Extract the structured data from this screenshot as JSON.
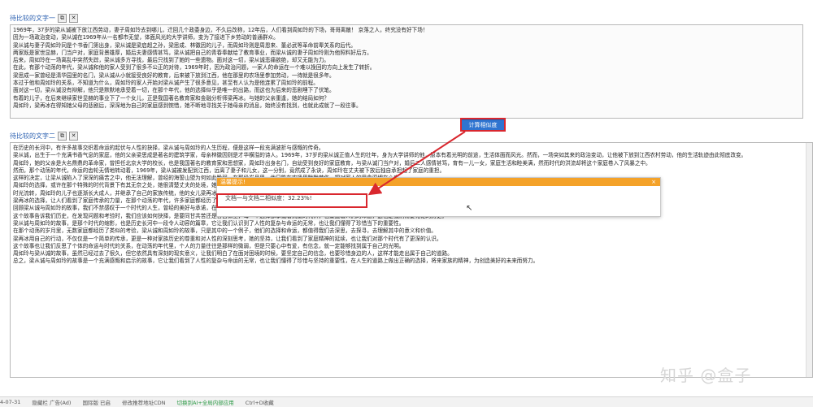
{
  "field1": {
    "label": "待比较的文字一",
    "lines": [
      "1969年，37岁的梁从诚被下放江西劳动，妻子周如玲去到哪儿，迁回几个政委身边，不久后改称，12年后，人们看到周如玲的下场，哥哥离散！ 京落之人，终究没有好下场！",
      "因为一场政治变动，梁从诚在1969年从一名都市无望，体面风光的大学讲师，变为了接进下乡劳动的普通群众。",
      "梁从诚与妻子周如玲同是个书香门第出身，梁从诚是梁启超之孙，梁思成、林徽因的儿子，而周如玲则是周恩来、董必武等革命前辈关系的后代。",
      "两家既是家世显赫，门当户对，家庭背景雄厚，婚后夫妻感情甚笃，梁从诚把自己的青春奉献给了教育事业，而梁从诚的妻子周如玲则为他照料好后方。",
      "后来，周如玲在一场离乱中突然失踪，梁从诚多方寻找，最后只找到了她的一些遗物。面对这一切，梁从诚悲痛欲绝，却又无能为力。",
      "在此，有那个动荡的年代，梁从诚和他的家人受到了很多不公正的对待，1969年时，因为政治问题，一家人的命运在一个难以挽回的方向上发生了转折。",
      "梁思成一家曾经是清华园里的名门，梁从诚从小就接受良好的教育，后来被下放到江西，他在那里的农场里参加劳动，一待就是很多年。",
      "本过于他和周如玲的关系，不知道为什么，周如玲的家人开始对梁从诚产生了很多意见，甚至有人认为是他连累了周如玲的前程。",
      "面对这一切，梁从诚没有辩解，他只是默默地承受着一切，在那个年代，他的选择似乎是唯一的出路，而这也为后来的悲剧埋下了伏笔。",
      "有着的儿子，在后来继续家世显赫的事业下了一个女儿，正是我国著名教育家和金融分析师梁再冰。与她的父亲重逢，她的结局如何？",
      "周如玲，梁再冰在得知她父母的悲剧后，深深地为自己的家庭感到惋惜，她不断地寻找关于她母亲的消息，始终没有找到，也就此成就了一段往事。"
    ]
  },
  "calc_button": "计算相似度",
  "field2": {
    "label": "待比较的文字二",
    "lines": [
      "在历史的长河中，有许多故事交织着命运的起伏与人性的抉择，梁从诚与周如玲的人生历程，便是这样一段充满波折与感慨的传奇。",
      "梁从诚，出生于一个充满书香气息的家庭，他的父亲梁思成是著名的建筑学家，母亲林徽因则是才华横溢的诗人。1969年，37岁的梁从诚正值人生的壮年，身为大学讲师的他，原本有着光明的前途，生活体面而风光。然而，一场突如其来的政治变动，让他被下放到江西农村劳动，他的生活轨迹由此彻底改变。",
      "周如玲，她的父亲是大名鼎鼎的革命家，曾担任北京大学的校长，也是我国著名的教育家和思想家，周如玲出身名门，自幼受到良好的家庭教育，与梁从诚门当户对，婚后二人感情甚笃，育有一儿一女，家庭生活和睦美满，然而时代的洪流却将这个家庭卷入了风暴之中。",
      "然而，那个动荡的年代，命运的齿轮无情地转动着，1969年，梁从诚被发配到江西，远离了妻子和儿女，这一分别，竟然成了永诀，周如玲在丈夫被下放后独自承担起了家庭的重担。",
      "这样的决定，让梁从诚陷入了深深的痛苦之中，他无法理解，曾经的海誓山盟为何如此脆弱，在那段岁月里，他只能在农场里默默劳作，把对家人的思念深埋在心底。",
      "周如玲的选择，或许在那个特殊的时代背景下有其无奈之处，她很清楚丈夫的处境，她也希望能够保护自己的孩子们，不受牵连。然而，命运似乎并没有眷顾她，在她47岁的那年，她突然病倒，不久便离开了人世，留下了无尽的遗憾。",
      "时光流转，周如玲的儿子也逐渐长大成人，并继承了自己的家族传统，他的女儿梁再冰，后来成为了我国著名的教育家和金融分析师，梁再冰在了解到家族的往事后，对父母的悲剧深感惋惜，她决心用自己的行动来弥补这份遗憾。",
      "梁再冰的选择，让人们看到了家庭传承的力量，在那个动荡的年代，许多家庭都经历了巨大的变故，但梁家的精神却依然在后代的身上得以延续，梁再冰用自己的行动，向世人展示了这份坚韧。",
      "回顾梁从诚与周如玲的故事，我们不禁感叹于一个时代的人生，曾经的美好与承诺，在时代的洪流中显得那样渺小而无力，然而他们的后代却在历史中找到了属于自己的方向，成为了人们心中的榜样。",
      "这个故事告诉我们历史，在发现问题和考验时，我们应该如何抉择，是要同甘共苦还是各自保全，每一个选择都承载着沉重的代价，也塑造着人们的命运，这也是我们需要铭记的历史。",
      "梁从诚与周如玲的故事，是那个时代的缩影，也是历史长河中一段令人动容的篇章，它让我们认识到了人性的复杂与命运的无常，也让我们懂得了珍惜当下的重要性。",
      "在那个动荡的岁月里，无数家庭都经历了类似的考验，梁从诚和周如玲的故事，只是其中的一个例子，他们的选择和命运，都值得我们去深思，去探寻，去理解其中的意义和价值。",
      "梁再冰用自己的行动，不仅仅是一个简单的传承，更是一种对家族历史的尊重和对人性的深刻思考，她的坚持，让我们看到了家庭精神的延续，也让我们对那个时代有了更深的认识。",
      "这个故事也让我们反思了个体的命运与时代的关系，在动荡的年代里，个人的力量往往是那样的微弱，但是只要心中有爱，有信念，就一定能够找到属于自己的光明。",
      "周如玲与梁从诚的故事，虽然已经过去了很久，但它依然具有深刻的现实意义，让我们明白了在面对困境的时候，要坚定自己的信念，也要珍惜身边的人，这样才能走出属于自己的道路。",
      "总之，梁从诚与周如玲的故事是一个充满感慨和启示的故事，它让我们看到了人性的复杂与命运的无常，也让我们懂得了珍惜与坚持的重要性，在人生的道路上做出正确的选择，将来家族的精神，为创造美好的未来而努力。"
    ]
  },
  "dialog": {
    "title": "温馨提示!",
    "close": "×",
    "message": "文档一与文档二相似度：32.23%!"
  },
  "taskbar": {
    "items": [
      "4-07-31",
      "隐藏栏  广告(Ad)",
      "国际版  已启",
      "修改推荐地址CDN",
      "切换到AI+全局内部应用",
      "Ctrl+D收藏"
    ]
  },
  "watermark": "知乎 @盒子",
  "colors": {
    "accent": "#2f74d0",
    "dialog_header": "#f4a229",
    "highlight": "#d9272e"
  }
}
